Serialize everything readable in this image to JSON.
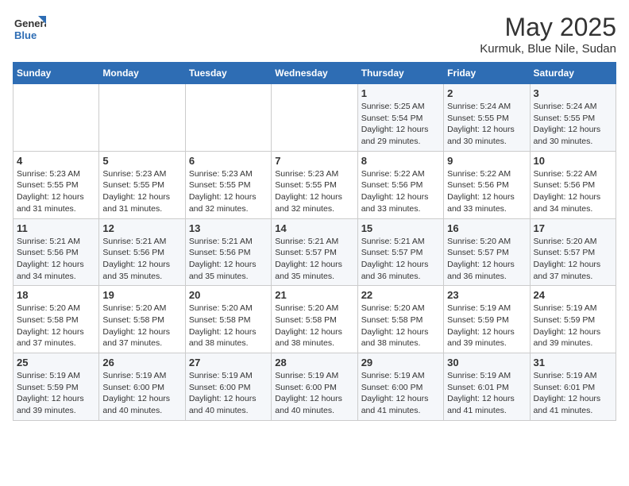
{
  "logo": {
    "line1": "General",
    "line2": "Blue"
  },
  "title": "May 2025",
  "subtitle": "Kurmuk, Blue Nile, Sudan",
  "days_header": [
    "Sunday",
    "Monday",
    "Tuesday",
    "Wednesday",
    "Thursday",
    "Friday",
    "Saturday"
  ],
  "weeks": [
    [
      {
        "day": "",
        "info": ""
      },
      {
        "day": "",
        "info": ""
      },
      {
        "day": "",
        "info": ""
      },
      {
        "day": "",
        "info": ""
      },
      {
        "day": "1",
        "info": "Sunrise: 5:25 AM\nSunset: 5:54 PM\nDaylight: 12 hours\nand 29 minutes."
      },
      {
        "day": "2",
        "info": "Sunrise: 5:24 AM\nSunset: 5:55 PM\nDaylight: 12 hours\nand 30 minutes."
      },
      {
        "day": "3",
        "info": "Sunrise: 5:24 AM\nSunset: 5:55 PM\nDaylight: 12 hours\nand 30 minutes."
      }
    ],
    [
      {
        "day": "4",
        "info": "Sunrise: 5:23 AM\nSunset: 5:55 PM\nDaylight: 12 hours\nand 31 minutes."
      },
      {
        "day": "5",
        "info": "Sunrise: 5:23 AM\nSunset: 5:55 PM\nDaylight: 12 hours\nand 31 minutes."
      },
      {
        "day": "6",
        "info": "Sunrise: 5:23 AM\nSunset: 5:55 PM\nDaylight: 12 hours\nand 32 minutes."
      },
      {
        "day": "7",
        "info": "Sunrise: 5:23 AM\nSunset: 5:55 PM\nDaylight: 12 hours\nand 32 minutes."
      },
      {
        "day": "8",
        "info": "Sunrise: 5:22 AM\nSunset: 5:56 PM\nDaylight: 12 hours\nand 33 minutes."
      },
      {
        "day": "9",
        "info": "Sunrise: 5:22 AM\nSunset: 5:56 PM\nDaylight: 12 hours\nand 33 minutes."
      },
      {
        "day": "10",
        "info": "Sunrise: 5:22 AM\nSunset: 5:56 PM\nDaylight: 12 hours\nand 34 minutes."
      }
    ],
    [
      {
        "day": "11",
        "info": "Sunrise: 5:21 AM\nSunset: 5:56 PM\nDaylight: 12 hours\nand 34 minutes."
      },
      {
        "day": "12",
        "info": "Sunrise: 5:21 AM\nSunset: 5:56 PM\nDaylight: 12 hours\nand 35 minutes."
      },
      {
        "day": "13",
        "info": "Sunrise: 5:21 AM\nSunset: 5:56 PM\nDaylight: 12 hours\nand 35 minutes."
      },
      {
        "day": "14",
        "info": "Sunrise: 5:21 AM\nSunset: 5:57 PM\nDaylight: 12 hours\nand 35 minutes."
      },
      {
        "day": "15",
        "info": "Sunrise: 5:21 AM\nSunset: 5:57 PM\nDaylight: 12 hours\nand 36 minutes."
      },
      {
        "day": "16",
        "info": "Sunrise: 5:20 AM\nSunset: 5:57 PM\nDaylight: 12 hours\nand 36 minutes."
      },
      {
        "day": "17",
        "info": "Sunrise: 5:20 AM\nSunset: 5:57 PM\nDaylight: 12 hours\nand 37 minutes."
      }
    ],
    [
      {
        "day": "18",
        "info": "Sunrise: 5:20 AM\nSunset: 5:58 PM\nDaylight: 12 hours\nand 37 minutes."
      },
      {
        "day": "19",
        "info": "Sunrise: 5:20 AM\nSunset: 5:58 PM\nDaylight: 12 hours\nand 37 minutes."
      },
      {
        "day": "20",
        "info": "Sunrise: 5:20 AM\nSunset: 5:58 PM\nDaylight: 12 hours\nand 38 minutes."
      },
      {
        "day": "21",
        "info": "Sunrise: 5:20 AM\nSunset: 5:58 PM\nDaylight: 12 hours\nand 38 minutes."
      },
      {
        "day": "22",
        "info": "Sunrise: 5:20 AM\nSunset: 5:58 PM\nDaylight: 12 hours\nand 38 minutes."
      },
      {
        "day": "23",
        "info": "Sunrise: 5:19 AM\nSunset: 5:59 PM\nDaylight: 12 hours\nand 39 minutes."
      },
      {
        "day": "24",
        "info": "Sunrise: 5:19 AM\nSunset: 5:59 PM\nDaylight: 12 hours\nand 39 minutes."
      }
    ],
    [
      {
        "day": "25",
        "info": "Sunrise: 5:19 AM\nSunset: 5:59 PM\nDaylight: 12 hours\nand 39 minutes."
      },
      {
        "day": "26",
        "info": "Sunrise: 5:19 AM\nSunset: 6:00 PM\nDaylight: 12 hours\nand 40 minutes."
      },
      {
        "day": "27",
        "info": "Sunrise: 5:19 AM\nSunset: 6:00 PM\nDaylight: 12 hours\nand 40 minutes."
      },
      {
        "day": "28",
        "info": "Sunrise: 5:19 AM\nSunset: 6:00 PM\nDaylight: 12 hours\nand 40 minutes."
      },
      {
        "day": "29",
        "info": "Sunrise: 5:19 AM\nSunset: 6:00 PM\nDaylight: 12 hours\nand 41 minutes."
      },
      {
        "day": "30",
        "info": "Sunrise: 5:19 AM\nSunset: 6:01 PM\nDaylight: 12 hours\nand 41 minutes."
      },
      {
        "day": "31",
        "info": "Sunrise: 5:19 AM\nSunset: 6:01 PM\nDaylight: 12 hours\nand 41 minutes."
      }
    ]
  ]
}
